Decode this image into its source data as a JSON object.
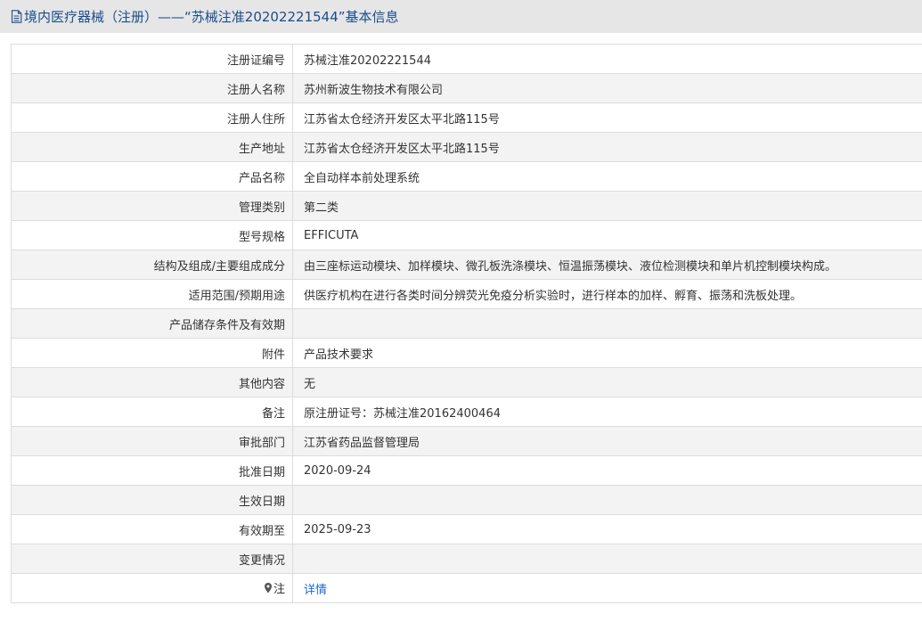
{
  "header": {
    "title": "境内医疗器械（注册）——“苏械注准20202221544”基本信息",
    "icon": "document-icon"
  },
  "rows": [
    {
      "label": "注册证编号",
      "value": "苏械注准20202221544"
    },
    {
      "label": "注册人名称",
      "value": "苏州新波生物技术有限公司"
    },
    {
      "label": "注册人住所",
      "value": "江苏省太仓经济开发区太平北路115号"
    },
    {
      "label": "生产地址",
      "value": "江苏省太仓经济开发区太平北路115号"
    },
    {
      "label": "产品名称",
      "value": "全自动样本前处理系统"
    },
    {
      "label": "管理类别",
      "value": "第二类"
    },
    {
      "label": "型号规格",
      "value": "EFFICUTA"
    },
    {
      "label": "结构及组成/主要组成成分",
      "value": "由三座标运动模块、加样模块、微孔板洗涤模块、恒温振荡模块、液位检测模块和单片机控制模块构成。"
    },
    {
      "label": "适用范围/预期用途",
      "value": "供医疗机构在进行各类时间分辨荧光免疫分析实验时，进行样本的加样、孵育、振荡和洗板处理。"
    },
    {
      "label": "产品储存条件及有效期",
      "value": ""
    },
    {
      "label": "附件",
      "value": "产品技术要求"
    },
    {
      "label": "其他内容",
      "value": "无"
    },
    {
      "label": "备注",
      "value": "原注册证号：苏械注准20162400464"
    },
    {
      "label": "审批部门",
      "value": "江苏省药品监督管理局"
    },
    {
      "label": "批准日期",
      "value": "2020-09-24"
    },
    {
      "label": "生效日期",
      "value": ""
    },
    {
      "label": "有效期至",
      "value": "2025-09-23"
    },
    {
      "label": "变更情况",
      "value": ""
    }
  ],
  "note": {
    "label": "注",
    "icon": "pin-icon",
    "link_text": "详情"
  },
  "colors": {
    "title": "#1a4d8c",
    "link": "#1a6ac8",
    "titlebar_bg": "#e6e6e6",
    "row_alt_bg": "#f3f3f3",
    "border": "#dcdcdc"
  }
}
